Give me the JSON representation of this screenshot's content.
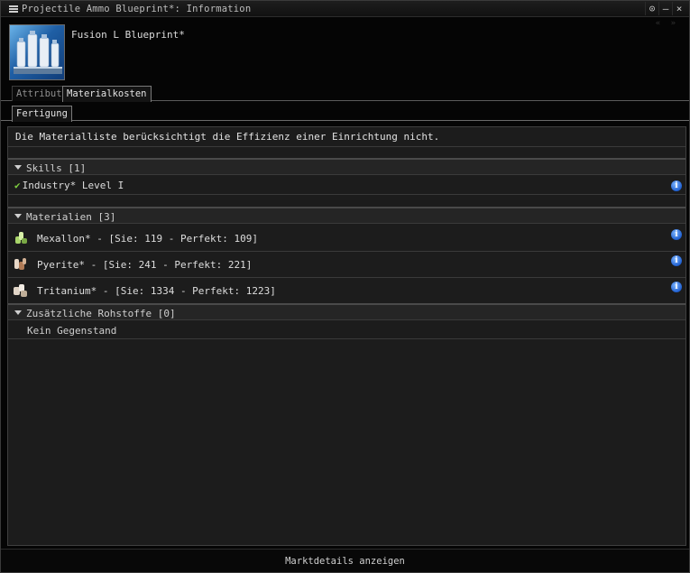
{
  "window": {
    "title": "Projectile Ammo Blueprint*: Information",
    "controls": [
      "⊙",
      "–",
      "×"
    ]
  },
  "item": {
    "name": "Fusion L Blueprint*",
    "icon": "blueprint-icon"
  },
  "tabs": [
    {
      "label": "Attribute",
      "active": false
    },
    {
      "label": "Materialkosten",
      "active": true
    }
  ],
  "subtabs": [
    {
      "label": "Fertigung",
      "active": true
    }
  ],
  "notice": "Die Materialliste berücksichtigt die Effizienz einer Einrichtung nicht.",
  "skills": {
    "header": "Skills  [1]",
    "items": [
      {
        "label": "Industry*  Level I",
        "status": "trained"
      }
    ]
  },
  "materials": {
    "header": "Materialien  [3]",
    "items": [
      {
        "label": "Mexallon* - [Sie: 119 - Perfekt: 109]",
        "icon": "mexallon-icon"
      },
      {
        "label": "Pyerite* - [Sie: 241 - Perfekt: 221]",
        "icon": "pyerite-icon"
      },
      {
        "label": "Tritanium* - [Sie: 1334 - Perfekt: 1223]",
        "icon": "tritanium-icon"
      }
    ]
  },
  "extra": {
    "header": "Zusätzliche Rohstoffe  [0]",
    "empty": "Kein Gegenstand"
  },
  "footer": {
    "market_button": "Marktdetails anzeigen"
  },
  "colors": {
    "info_blue": "#1f5fd0",
    "check_green": "#7fd040"
  }
}
